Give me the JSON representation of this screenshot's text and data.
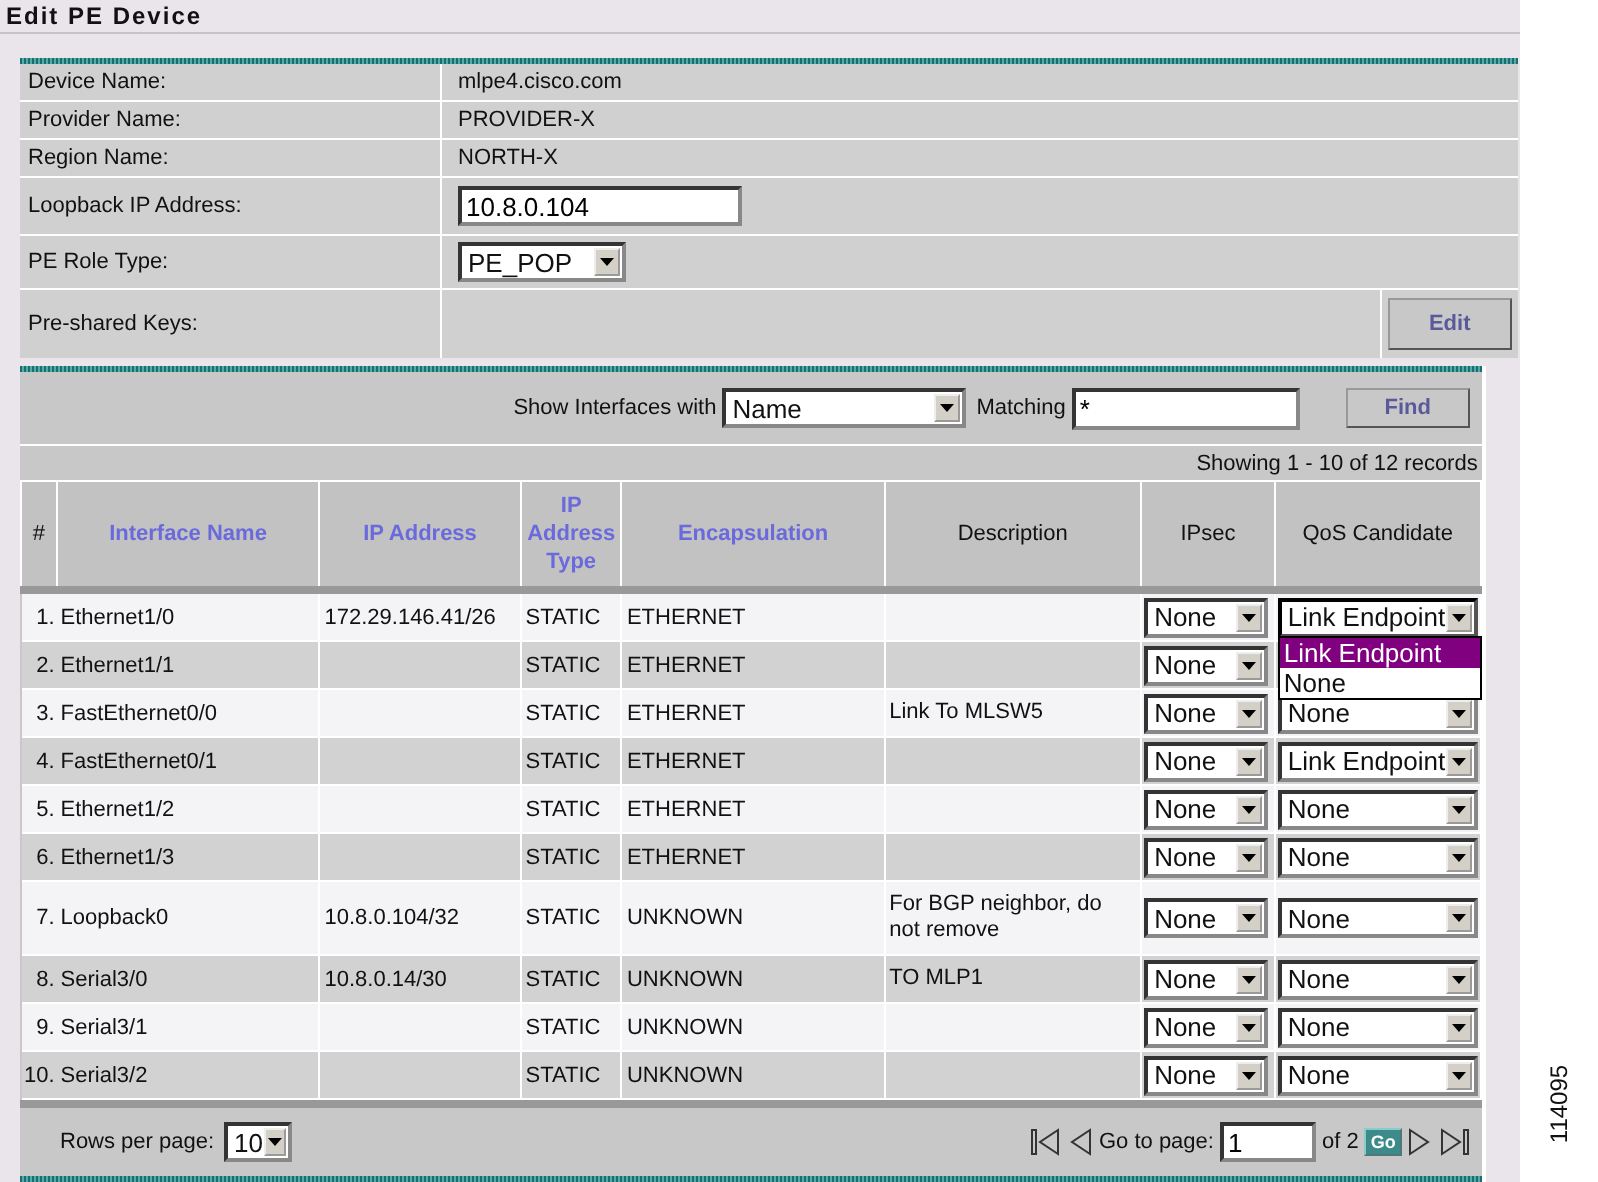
{
  "title": "Edit PE Device",
  "device_fields": [
    {
      "label": "Device Name:",
      "kind": "text",
      "value": "mlpe4.cisco.com"
    },
    {
      "label": "Provider Name:",
      "kind": "text",
      "value": "PROVIDER-X"
    },
    {
      "label": "Region Name:",
      "kind": "text",
      "value": "NORTH-X"
    },
    {
      "label": "Loopback IP Address:",
      "kind": "input",
      "value": "10.8.0.104"
    },
    {
      "label": "PE Role Type:",
      "kind": "select",
      "value": "PE_POP"
    },
    {
      "label": "Pre-shared Keys:",
      "kind": "button",
      "value": "Edit"
    }
  ],
  "filter": {
    "label": "Show Interfaces with",
    "field": "Name",
    "matching_label": "Matching",
    "matching_value": "*",
    "button": "Find"
  },
  "records": "Showing 1 - 10 of 12 records",
  "columns": [
    {
      "label": "#",
      "sortable": false
    },
    {
      "label": "Interface Name",
      "sortable": true
    },
    {
      "label": "IP Address",
      "sortable": true
    },
    {
      "label": "IP Address Type",
      "sortable": true
    },
    {
      "label": "Encapsulation",
      "sortable": true
    },
    {
      "label": "Description",
      "sortable": false
    },
    {
      "label": "IPsec",
      "sortable": false
    },
    {
      "label": "QoS Candidate",
      "sortable": false
    }
  ],
  "rows": [
    {
      "num": "1.",
      "name": "Ethernet1/0",
      "ip": "172.29.146.41/26",
      "type": "STATIC",
      "encap": "ETHERNET",
      "description": "",
      "ipsec": "None",
      "qos": "Link Endpoint",
      "open": true
    },
    {
      "num": "2.",
      "name": "Ethernet1/1",
      "ip": "",
      "type": "STATIC",
      "encap": "ETHERNET",
      "description": "",
      "ipsec": "None",
      "qos": "",
      "open": false
    },
    {
      "num": "3.",
      "name": "FastEthernet0/0",
      "ip": "",
      "type": "STATIC",
      "encap": "ETHERNET",
      "description": "Link To MLSW5",
      "ipsec": "None",
      "qos": "None",
      "open": false
    },
    {
      "num": "4.",
      "name": "FastEthernet0/1",
      "ip": "",
      "type": "STATIC",
      "encap": "ETHERNET",
      "description": "",
      "ipsec": "None",
      "qos": "Link Endpoint",
      "open": false
    },
    {
      "num": "5.",
      "name": "Ethernet1/2",
      "ip": "",
      "type": "STATIC",
      "encap": "ETHERNET",
      "description": "",
      "ipsec": "None",
      "qos": "None",
      "open": false
    },
    {
      "num": "6.",
      "name": "Ethernet1/3",
      "ip": "",
      "type": "STATIC",
      "encap": "ETHERNET",
      "description": "",
      "ipsec": "None",
      "qos": "None",
      "open": false
    },
    {
      "num": "7.",
      "name": "Loopback0",
      "ip": "10.8.0.104/32",
      "type": "STATIC",
      "encap": "UNKNOWN",
      "description": "For BGP neighbor, do not remove",
      "ipsec": "None",
      "qos": "None",
      "open": false
    },
    {
      "num": "8.",
      "name": "Serial3/0",
      "ip": "10.8.0.14/30",
      "type": "STATIC",
      "encap": "UNKNOWN",
      "description": "TO MLP1",
      "ipsec": "None",
      "qos": "None",
      "open": false
    },
    {
      "num": "9.",
      "name": "Serial3/1",
      "ip": "",
      "type": "STATIC",
      "encap": "UNKNOWN",
      "description": "",
      "ipsec": "None",
      "qos": "None",
      "open": false
    },
    {
      "num": "10.",
      "name": "Serial3/2",
      "ip": "",
      "type": "STATIC",
      "encap": "UNKNOWN",
      "description": "",
      "ipsec": "None",
      "qos": "None",
      "open": false
    }
  ],
  "dropdown_options": [
    {
      "label": "Link Endpoint",
      "selected": true
    },
    {
      "label": "None",
      "selected": false
    }
  ],
  "footer": {
    "rows_label": "Rows per page:",
    "rows_value": "10",
    "goto_label": "Go to page:",
    "page": "1",
    "of": "of 2",
    "go": "Go"
  },
  "figure_id": "114095"
}
